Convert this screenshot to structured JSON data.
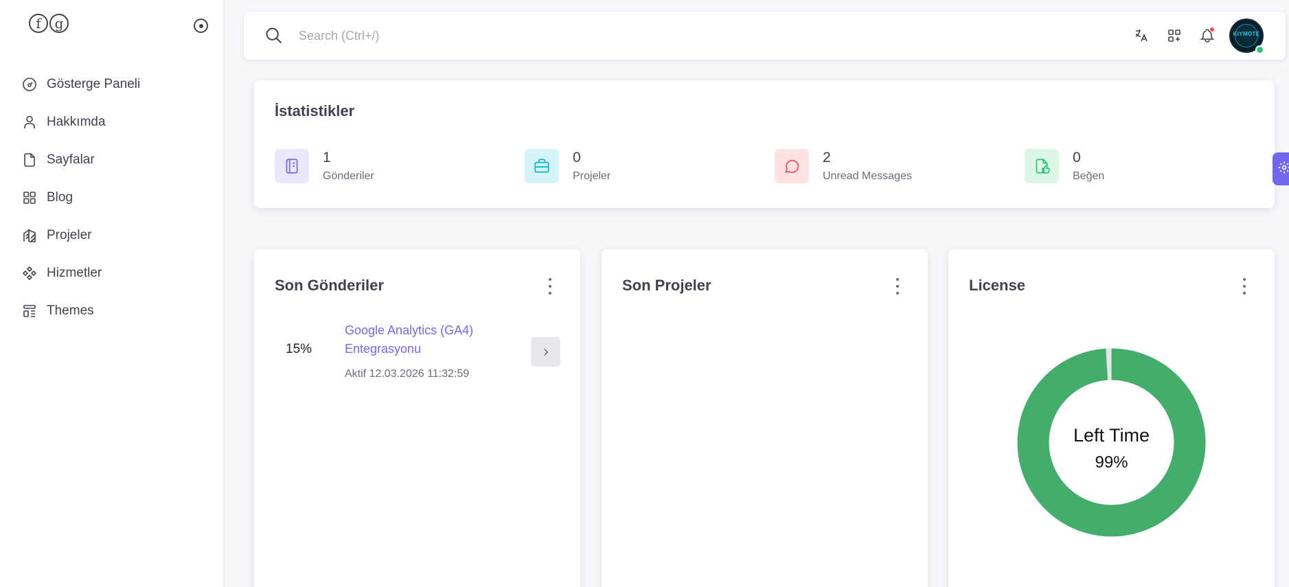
{
  "sidebar": {
    "logo_letters": [
      "f",
      "g"
    ],
    "items": [
      {
        "label": "Gösterge Paneli",
        "icon": "dashboard-icon"
      },
      {
        "label": "Hakkımda",
        "icon": "user-icon"
      },
      {
        "label": "Sayfalar",
        "icon": "file-icon"
      },
      {
        "label": "Blog",
        "icon": "grid-icon"
      },
      {
        "label": "Projeler",
        "icon": "building-icon"
      },
      {
        "label": "Hizmetler",
        "icon": "components-icon"
      },
      {
        "label": "Themes",
        "icon": "layout-icon"
      }
    ]
  },
  "header": {
    "search_placeholder": "Search (Ctrl+/)",
    "icons": [
      "language-icon",
      "apps-plus-icon",
      "bell-icon"
    ],
    "avatar_text": "KIYMOTE",
    "notification_color": "#ff4c51",
    "online_color": "#28c76f"
  },
  "stats": {
    "title": "İstatistikler",
    "items": [
      {
        "value": "1",
        "label": "Gönderiler",
        "icon": "notebook-icon",
        "color": "#7367f0",
        "bg": "#eae8fd"
      },
      {
        "value": "0",
        "label": "Projeler",
        "icon": "briefcase-icon",
        "color": "#00bad1",
        "bg": "#d6f4f8"
      },
      {
        "value": "2",
        "label": "Unread Messages",
        "icon": "message-icon",
        "color": "#ff4c51",
        "bg": "#ffe2e3"
      },
      {
        "value": "0",
        "label": "Beğen",
        "icon": "thumb-up-icon",
        "color": "#28c76f",
        "bg": "#dcf6e8"
      }
    ]
  },
  "recent_posts": {
    "title": "Son Gönderiler",
    "items": [
      {
        "percent": "15%",
        "title": "Google Analytics (GA4) Entegrasyonu",
        "meta": "Aktif 12.03.2026 11:32:59"
      }
    ]
  },
  "recent_projects": {
    "title": "Son Projeler"
  },
  "license": {
    "title": "License",
    "center_label": "Left Time",
    "center_value": "99%",
    "remaining_fraction": 0.99,
    "ring_color": "#43ad6b"
  },
  "accent_color": "#7367f0"
}
